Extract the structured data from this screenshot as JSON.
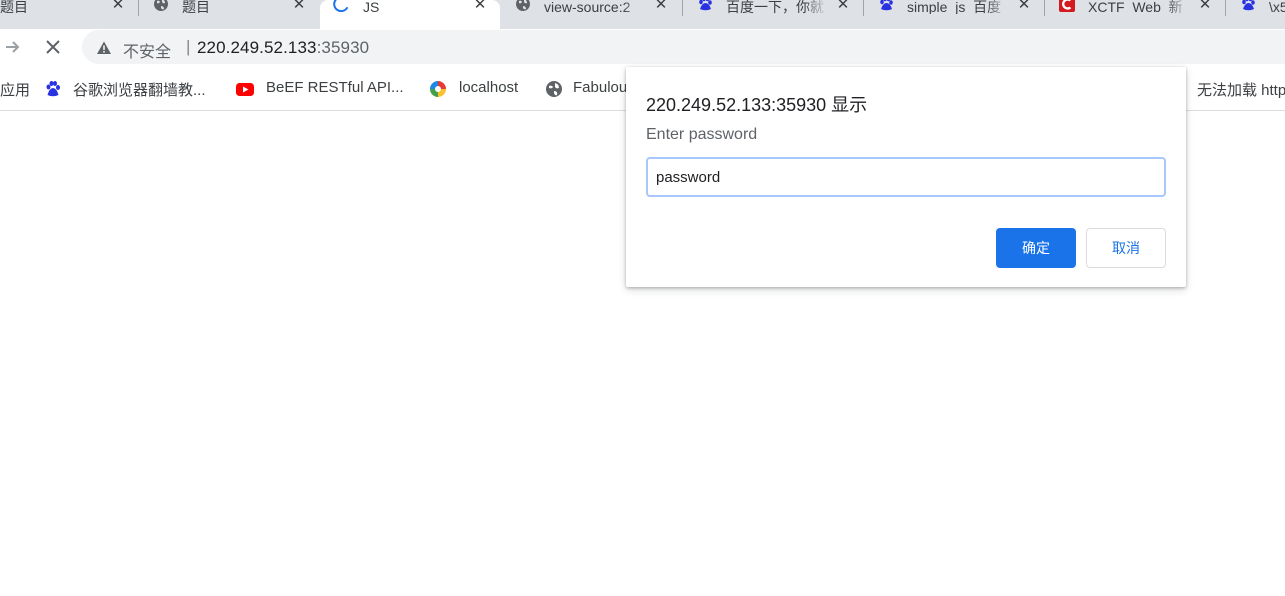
{
  "tabs": [
    {
      "title": "题目",
      "favicon": "none",
      "active": false
    },
    {
      "title": "题目",
      "favicon": "globe-icon",
      "active": false
    },
    {
      "title": "JS",
      "favicon": "loading-spinner-icon",
      "active": true
    },
    {
      "title": "view-source:2",
      "favicon": "globe-icon",
      "active": false
    },
    {
      "title": "百度一下，你就",
      "favicon": "baidu-paw-icon",
      "active": false
    },
    {
      "title": "simple_js_百度",
      "favicon": "baidu-paw-icon",
      "active": false
    },
    {
      "title": "XCTF_Web_新",
      "favicon": "xctf-icon",
      "active": false
    },
    {
      "title": "\\x5",
      "favicon": "baidu-paw-icon",
      "active": false
    }
  ],
  "toolbar": {
    "security_label": "不安全",
    "url_host": "220.249.52.133",
    "url_port": ":35930"
  },
  "bookmarks": [
    {
      "label": "应用",
      "icon": "apps-icon"
    },
    {
      "label": "谷歌浏览器翻墙教...",
      "icon": "baidu-paw-icon"
    },
    {
      "label": "BeEF RESTful API...",
      "icon": "youtube-icon"
    },
    {
      "label": "localhost",
      "icon": "colorful-ring-icon"
    },
    {
      "label": "Fabulou",
      "icon": "globe-icon"
    },
    {
      "label": "无法加载 http",
      "icon": "none"
    }
  ],
  "dialog": {
    "title": "220.249.52.133:35930 显示",
    "message": "Enter password",
    "input_value": "password",
    "ok_label": "确定",
    "cancel_label": "取消"
  },
  "colors": {
    "accent": "#1a73e8",
    "tabstrip": "#dee1e6",
    "omnibox": "#f1f3f4"
  }
}
